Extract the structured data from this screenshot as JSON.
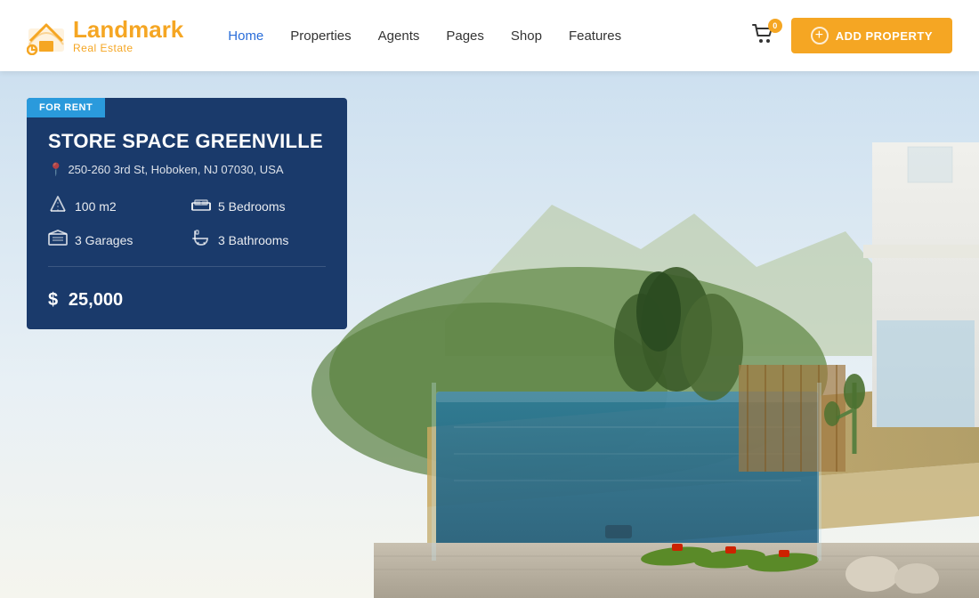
{
  "header": {
    "logo": {
      "brand_prefix": "Land",
      "brand_suffix": "mark",
      "tagline": "Real Estate"
    },
    "nav": {
      "items": [
        {
          "label": "Home",
          "active": true
        },
        {
          "label": "Properties",
          "active": false
        },
        {
          "label": "Agents",
          "active": false
        },
        {
          "label": "Pages",
          "active": false
        },
        {
          "label": "Shop",
          "active": false
        },
        {
          "label": "Features",
          "active": false
        }
      ]
    },
    "cart": {
      "badge": "0"
    },
    "add_property_btn": "ADD PROPERTY"
  },
  "hero": {
    "badge": "FOR RENT",
    "title": "STORE SPACE GREENVILLE",
    "address": "250-260 3rd St, Hoboken, NJ 07030, USA",
    "features": [
      {
        "icon": "area",
        "label": "100 m2"
      },
      {
        "icon": "bed",
        "label": "5 Bedrooms"
      },
      {
        "icon": "garage",
        "label": "3 Garages"
      },
      {
        "icon": "bath",
        "label": "3 Bathrooms"
      }
    ],
    "price_symbol": "$",
    "price": "25,000"
  },
  "colors": {
    "accent_orange": "#f5a623",
    "accent_blue": "#2a6dd9",
    "badge_blue": "#2a9adc",
    "card_bg": "#1a3a6b"
  }
}
